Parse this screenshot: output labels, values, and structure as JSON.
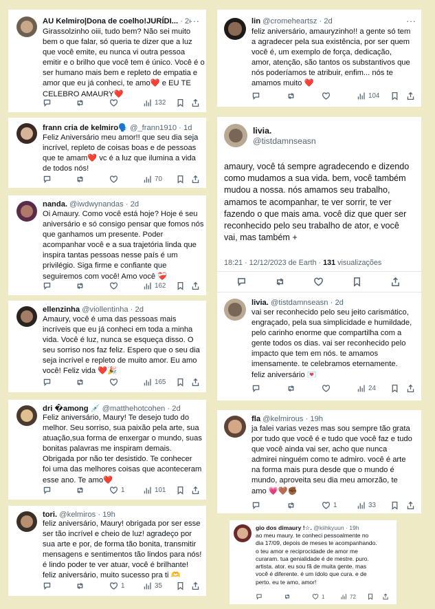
{
  "icons": {
    "reply": "reply-icon",
    "retweet": "retweet-icon",
    "like": "like-icon",
    "views": "views-icon",
    "bookmark": "bookmark-icon",
    "share": "share-icon",
    "more": "more-dots-icon"
  },
  "colors": {
    "background": "#efeac6",
    "card": "#ffffff",
    "muted": "#536471",
    "heart": "#e0245e"
  },
  "left": [
    {
      "name": "AU Kelmiro|Dona de coelho!JURÍDI...",
      "handle": "",
      "time": "· 2d",
      "text": "Girassolzinho oiii, tudo bem? Não sei muito\nbem o que falar, só queria te dizer que a luz\nque você emite, eu nunca vi outra pessoa\nemitir e o brilho que você tem é único. Você é o\nser humano mais bem e repleto de empatia e\namor que eu já conheci, te amo❤️ e EU TE\nCELEBRO AMAURY❤️",
      "likes": "",
      "views": "132"
    },
    {
      "name": "frann cria de kelmiro🗣️",
      "handle": "@_frann1910",
      "time": "· 1d",
      "text": "Feliz Aniversário meu amor!! que seu dia seja\nincrível, repleto de coisas boas e de pessoas\nque te amam❤️ vc é a luz que ilumina a vida\nde todos nós!",
      "likes": "",
      "views": "70"
    },
    {
      "name": "nanda.",
      "handle": "@iwdwynandas",
      "time": "· 2d",
      "text": "Oi Amaury. Como você está hoje? Hoje é seu\naniversário e só consigo pensar que fomos nós\nque ganhamos um presente. Poder\nacompanhar você e a sua trajetória linda que\ninspira tantas pessoas nesse país é um\nprivilégio. Siga firme e confiante que\nseguiremos com você! Amo você ❤️‍🩹",
      "likes": "",
      "views": "162"
    },
    {
      "name": "ellenzinha",
      "handle": "@viollentinha",
      "time": "· 2d",
      "text": "Amaury, você é uma das pessoas mais\nincríveis que eu já conheci em toda a minha\nvida. Você é luz, nunca se esqueça disso. O\nseu sorriso nos faz feliz. Espero que o seu dia\nseja incrível e repleto de muito amor. Eu amo\nvocê! Feliz vida ❤️🎉",
      "likes": "",
      "views": "165"
    },
    {
      "name": "dri �among 💉",
      "handle": "@matthehotcohen",
      "time": "· 2d",
      "text": "Feliz aniversário, Maury! Te desejo tudo do\nmelhor. Seu sorriso, sua paixão pela arte, sua\natuação,sua forma de enxergar o mundo, suas\nbonitas palavras me inspiram demais.\nObrigada por não ter desistido. Te conhecer\nfoi uma das melhores coisas que aconteceram\nesse ano. Te amo❤️",
      "likes": "1",
      "views": "101"
    },
    {
      "name": "tori.",
      "handle": "@kelmiros",
      "time": "· 19h",
      "text": "feliz aniversário, Maury! obrigada por ser esse\nser tão incrível e cheio de luz! agradeço por\nsua arte e por, de forma tão bonita, transmitir\nmensagens e sentimentos tão lindos para nós!\né lindo poder te ver atuar, você é brilhante!\nfeliz aniversário, muito sucesso pra ti 🫶",
      "likes": "1",
      "views": "35"
    }
  ],
  "right": [
    {
      "name": "lin",
      "handle": "@cromeheartsz",
      "time": "· 2d",
      "text": "feliz aniversário, amauryzinho!! a gente só tem\na agradecer pela sua existência, por ser quem\nvocê é, um exemplo de força, dedicação,\namor, atenção, são tantos os substantivos que\nnós poderíamos te atribuir, enfim... nós te\namamos muito ❤️",
      "likes": "",
      "views": "104"
    },
    {
      "name": "livia.",
      "handle": "@tistdamnseasn",
      "time": "",
      "text": "amaury, você tá sempre agradecendo e dizendo\ncomo mudamos a sua vida. bem, você também\nmudou a nossa. nós amamos seu trabalho,\namamos te acompanhar, te ver sorrir, te ver\nfazendo o que mais ama. você diz que quer ser\nreconhecido pelo seu trabalho de ator, e você\nvai, mas também +",
      "meta_time": "18:21 · 12/12/2023 de Earth · ",
      "meta_views": "131",
      "meta_label": " visualizações"
    },
    {
      "name": "livia.",
      "handle": "@tistdamnseasn",
      "time": "· 2d",
      "text": "vai ser reconhecido pelo seu jeito carismático,\nengraçado, pela sua simplicidade e humildade,\npelo carinho enorme que compartilha com a\ngente todos os dias. vai ser reconhecido pelo\nimpacto que tem em nós. te amamos\nimensamente. te celebramos eternamente.\nfeliz aniversário 💌",
      "likes": "",
      "views": "24"
    },
    {
      "name": "fla",
      "handle": "@kelmirous",
      "time": "· 19h",
      "text": "ja falei varias vezes mas sou sempre tão grata\npor tudo que você é e tudo que você faz e tudo\nque você ainda vai ser, acho que nunca\nadmirei ninguém como te admiro. você é arte\nna forma mais pura desde que o mundo é\nmundo, aproveita seu dia meu amorzão, te\namo 💗🤎✊🏾",
      "likes": "1",
      "views": "33"
    },
    {
      "name": "gio dos dimaury !☆.",
      "handle": "@kiihkyuun",
      "time": "· 19h",
      "text": "ao meu maury. te conheci pessoalmente no\ndia 17/09, depois de meses te acompanhando.\no teu amor e reciprocidade de amor me\ncuraram. tua genialidade é de mestre. puro.\nartista. ator. eu sou fã de muita gente. mas\nvocê é diferente. é um ídolo que cura. e de\nperto. eu te amo, amor!",
      "likes": "1",
      "views": "72"
    }
  ]
}
